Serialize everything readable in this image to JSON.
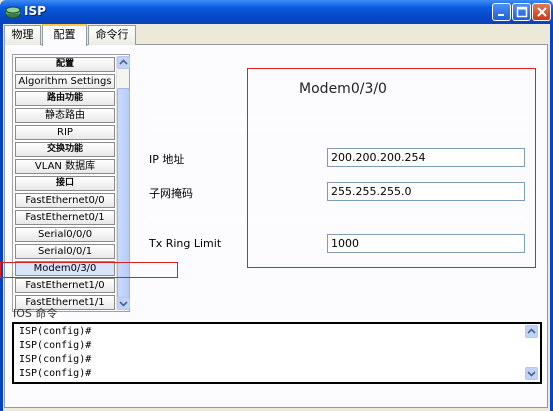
{
  "window": {
    "title": "ISP"
  },
  "tabs": [
    {
      "label": "物理"
    },
    {
      "label": "配置"
    },
    {
      "label": "命令行"
    }
  ],
  "sidebar": {
    "items": [
      {
        "label": "配置",
        "header": true
      },
      {
        "label": "Algorithm Settings",
        "header": false
      },
      {
        "label": "路由功能",
        "header": true
      },
      {
        "label": "静态路由",
        "header": false
      },
      {
        "label": "RIP",
        "header": false
      },
      {
        "label": "交换功能",
        "header": true
      },
      {
        "label": "VLAN 数据库",
        "header": false
      },
      {
        "label": "接口",
        "header": true
      },
      {
        "label": "FastEthernet0/0",
        "header": false
      },
      {
        "label": "FastEthernet0/1",
        "header": false
      },
      {
        "label": "Serial0/0/0",
        "header": false
      },
      {
        "label": "Serial0/0/1",
        "header": false
      },
      {
        "label": "Modem0/3/0",
        "header": false,
        "selected": true
      },
      {
        "label": "FastEthernet1/0",
        "header": false
      },
      {
        "label": "FastEthernet1/1",
        "header": false
      }
    ]
  },
  "interface": {
    "name": "Modem0/3/0",
    "ip_label": "IP 地址",
    "ip_value": "200.200.200.254",
    "mask_label": "子网掩码",
    "mask_value": "255.255.255.0",
    "txring_label": "Tx Ring Limit",
    "txring_value": "1000"
  },
  "ios": {
    "label": "IOS 命令",
    "lines": [
      "ISP(config)#",
      "ISP(config)#",
      "ISP(config)#",
      "ISP(config)#"
    ]
  },
  "colors": {
    "annotation": "#e02020",
    "titlebar": "#0a5ce0"
  }
}
